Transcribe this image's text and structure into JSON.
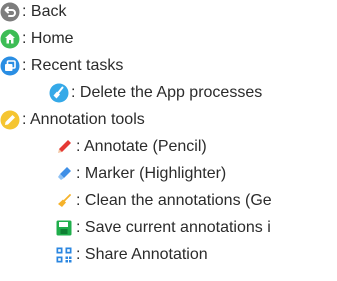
{
  "legend": {
    "items": [
      {
        "icon": "back-circle-icon",
        "label": ": Back",
        "color": "#7d7d7d"
      },
      {
        "icon": "home-circle-icon",
        "label": ": Home",
        "color": "#3dbd55"
      },
      {
        "icon": "recent-tasks-circle-icon",
        "label": ": Recent tasks",
        "color": "#2a8ee3"
      },
      {
        "icon": "broom-circle-icon",
        "label": ": Delete the App processes",
        "color": "#35a9e8"
      },
      {
        "icon": "pencil-circle-icon",
        "label": ": Annotation tools",
        "color": "#f5c531"
      },
      {
        "icon": "red-pencil-icon",
        "label": ": Annotate (Pencil)",
        "color": "#e53935"
      },
      {
        "icon": "blue-marker-icon",
        "label": ": Marker (Highlighter)",
        "color": "#3f8fe6"
      },
      {
        "icon": "eraser-broom-icon",
        "label": ": Clean the annotations (Ge",
        "color": "#f5b22a"
      },
      {
        "icon": "save-floppy-icon",
        "label": ": Save current annotations i",
        "color": "#1fae4b"
      },
      {
        "icon": "qr-code-icon",
        "label": ": Share Annotation",
        "color": "#2a86e0"
      }
    ]
  }
}
